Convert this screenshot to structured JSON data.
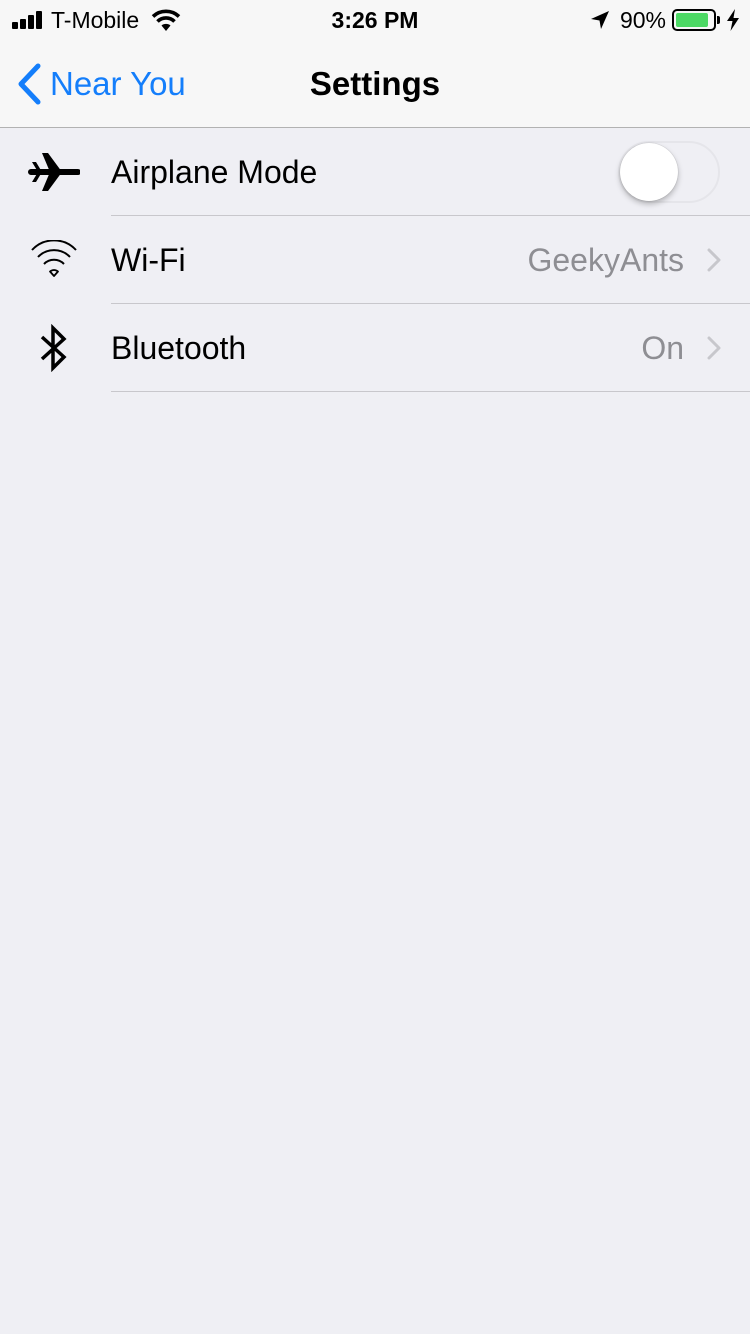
{
  "status_bar": {
    "carrier": "T-Mobile",
    "time": "3:26 PM",
    "battery_percent": "90%",
    "battery_level": 0.9,
    "battery_color": "#4cd964",
    "icons": [
      "signal-icon",
      "wifi-icon",
      "location-arrow-icon",
      "battery-icon",
      "charging-bolt-icon"
    ]
  },
  "nav_bar": {
    "back_label": "Near You",
    "title": "Settings",
    "accent_color": "#147efb"
  },
  "settings": [
    {
      "icon": "airplane-icon",
      "label": "Airplane Mode",
      "control": "toggle",
      "toggle_on": false
    },
    {
      "icon": "wifi-icon",
      "label": "Wi-Fi",
      "value": "GeekyAnts",
      "control": "chevron"
    },
    {
      "icon": "bluetooth-icon",
      "label": "Bluetooth",
      "value": "On",
      "control": "chevron"
    }
  ]
}
